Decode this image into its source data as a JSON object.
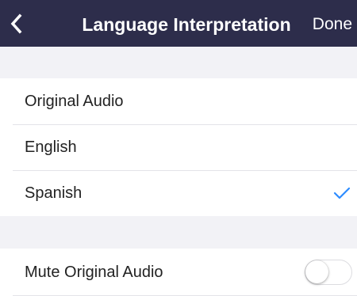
{
  "nav": {
    "title": "Language Interpretation",
    "done_label": "Done",
    "background": "#2d2d4b"
  },
  "languages": [
    {
      "label": "Original Audio",
      "selected": false
    },
    {
      "label": "English",
      "selected": false
    },
    {
      "label": "Spanish",
      "selected": true
    }
  ],
  "mute": {
    "label": "Mute Original Audio",
    "enabled": false
  },
  "accent_color": "#2d8cff",
  "icons": {
    "back": "chevron-left-icon",
    "selected": "checkmark-icon"
  }
}
